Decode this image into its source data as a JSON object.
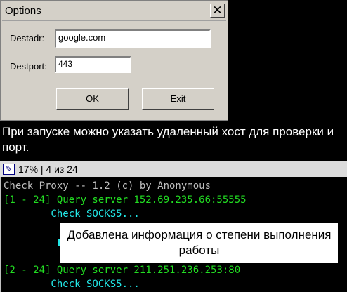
{
  "dialog": {
    "title": "Options",
    "close_glyph": "✕",
    "destadr_label": "Destadr:",
    "destadr_value": "google.com",
    "destport_label": "Destport:",
    "destport_value": "443",
    "ok_label": "OK",
    "exit_label": "Exit"
  },
  "caption": "При запуске можно указать удаленный хост для проверки и порт.",
  "console_window": {
    "icon": "app-icon",
    "title": "17% | 4 из 24"
  },
  "console": {
    "header": "Check Proxy -- 1.2 (c) by Anonymous",
    "line1": "[1 - 24] Query server 152.69.235.66:55555",
    "line2": "        Check SOCKS5...",
    "line3": "[2 - 24] Query server 211.251.236.253:80",
    "line4": "        Check SOCKS5..."
  },
  "annotation": "Добавлена информация о степени выполнения работы",
  "colors": {
    "console_green": "#22dd22",
    "console_cyan": "#22e6e6",
    "console_gray": "#c0c0c0"
  }
}
